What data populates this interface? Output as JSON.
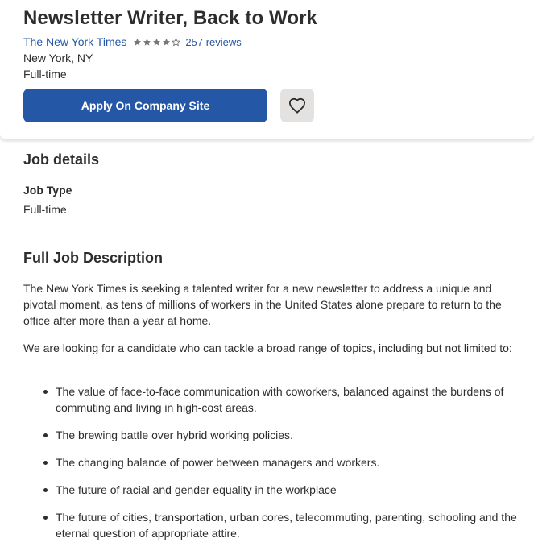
{
  "header": {
    "job_title": "Newsletter Writer, Back to Work",
    "company": "The New York Times",
    "rating": 4,
    "reviews": "257 reviews",
    "location": "New York, NY",
    "job_type": "Full-time",
    "apply_label": "Apply On Company Site",
    "save_icon": "heart-icon"
  },
  "job_details": {
    "title": "Job details",
    "type_label": "Job Type",
    "type_value": "Full-time"
  },
  "description": {
    "title": "Full Job Description",
    "paragraphs": [
      "The New York Times is seeking a talented writer for a new newsletter to address a unique and pivotal moment, as tens of millions of workers in the United States alone prepare to return to the office after more than a year at home.",
      "We are looking for a candidate who can tackle a broad range of topics, including but not limited to:"
    ],
    "bullets": [
      "The value of face-to-face communication with coworkers, balanced against the burdens of commuting and living in high-cost areas.",
      "The brewing battle over hybrid working policies.",
      "The changing balance of power between managers and workers.",
      "The future of racial and gender equality in the workplace",
      "The future of cities, transportation, urban cores, telecommuting, parenting, schooling and the eternal question of appropriate attire."
    ]
  },
  "colors": {
    "accent": "#2557a7",
    "text": "#2d2d2d",
    "save_bg": "#e4e2e0",
    "star": "#767676"
  }
}
